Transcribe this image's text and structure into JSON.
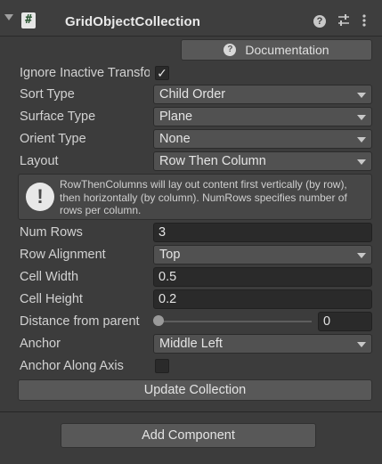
{
  "header": {
    "title": "GridObjectCollection",
    "script_icon_glyph": "#",
    "help_glyph": "?",
    "icons": [
      "foldout-arrow-icon",
      "script-icon",
      "help-icon",
      "preset-sliders-icon",
      "more-kebab-icon"
    ]
  },
  "documentation_button": {
    "label": "Documentation",
    "icon_glyph": "?"
  },
  "fields": {
    "ignore_inactive": {
      "label": "Ignore Inactive Transforms",
      "checked": true,
      "check_glyph": "✓"
    },
    "sort_type": {
      "label": "Sort Type",
      "value": "Child Order"
    },
    "surface_type": {
      "label": "Surface Type",
      "value": "Plane"
    },
    "orient_type": {
      "label": "Orient Type",
      "value": "None"
    },
    "layout": {
      "label": "Layout",
      "value": "Row Then Column"
    },
    "num_rows": {
      "label": "Num Rows",
      "value": "3"
    },
    "row_alignment": {
      "label": "Row Alignment",
      "value": "Top"
    },
    "cell_width": {
      "label": "Cell Width",
      "value": "0.5"
    },
    "cell_height": {
      "label": "Cell Height",
      "value": "0.2"
    },
    "distance_from_parent": {
      "label": "Distance from parent",
      "value": "0",
      "slider_fraction": 0
    },
    "anchor": {
      "label": "Anchor",
      "value": "Middle Left"
    },
    "anchor_along_axis": {
      "label": "Anchor Along Axis",
      "checked": false
    }
  },
  "helpbox": {
    "icon_glyph": "!",
    "text": "RowThenColumns will lay out content first vertically (by row), then horizontally (by column). NumRows specifies number of rows per column."
  },
  "update_button": {
    "label": "Update Collection"
  },
  "add_component_button": {
    "label": "Add Component"
  },
  "colors": {
    "background": "#3c3c3c",
    "field": "#2a2a2a",
    "dropdown": "#515151",
    "button": "#585858",
    "text": "#d2d2d2"
  }
}
